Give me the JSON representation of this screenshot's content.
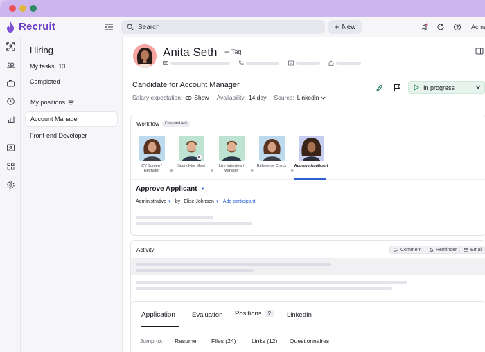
{
  "app": {
    "name": "Recruit",
    "brand_color": "#6b3fc4"
  },
  "topbar": {
    "search_placeholder": "Search",
    "new_label": "New",
    "company": "Acme",
    "icons": [
      "megaphone-icon",
      "refresh-icon",
      "help-icon"
    ]
  },
  "rail": {
    "icons": [
      "scan-icon",
      "people-icon",
      "briefcase-icon",
      "clock-icon",
      "chart-icon",
      "contact-card-icon",
      "apps-icon",
      "settings-icon"
    ]
  },
  "sidebar": {
    "title": "Hiring",
    "my_tasks_label": "My tasks",
    "my_tasks_count": "13",
    "completed_label": "Completed",
    "positions_label": "My positions",
    "positions": [
      "Account Manager",
      "Front-end Developer"
    ]
  },
  "candidate": {
    "name": "Anita Seth",
    "tag_label": "Tag",
    "headline": "Candidate for Account Manager",
    "salary_label": "Salary expectation:",
    "salary_value": "Show",
    "availability_label": "Availability:",
    "availability_value": "14 day",
    "source_label": "Source:",
    "source_value": "Linkedin",
    "status": "In progress",
    "status_color": "#2f8a66"
  },
  "workflow": {
    "title": "Workflow",
    "badge": "Customized",
    "steps": [
      {
        "label": "CV Screen / Recruiter"
      },
      {
        "label": "Spark Hire Meet"
      },
      {
        "label": "Live Interview / Manager"
      },
      {
        "label": "Reference Check"
      },
      {
        "label": "Approve Applicant"
      }
    ],
    "active_stage": "Approve Applicant",
    "stage_type": "Administrative",
    "by_label": "by",
    "assignee": "Elise Johnson",
    "add_participant": "Add participant"
  },
  "activity": {
    "title": "Activity",
    "comment_label": "Comment",
    "reminder_label": "Reminder",
    "email_label": "Email"
  },
  "tabs": {
    "application": "Application",
    "evaluation": "Evaluation",
    "positions": "Positions",
    "positions_count": "2",
    "linkedin": "LinkedIn"
  },
  "jump": {
    "label": "Jump to:",
    "resume": "Resume",
    "files": "Files (24)",
    "links": "Links (12)",
    "questionnaires": "Questionnaires"
  }
}
